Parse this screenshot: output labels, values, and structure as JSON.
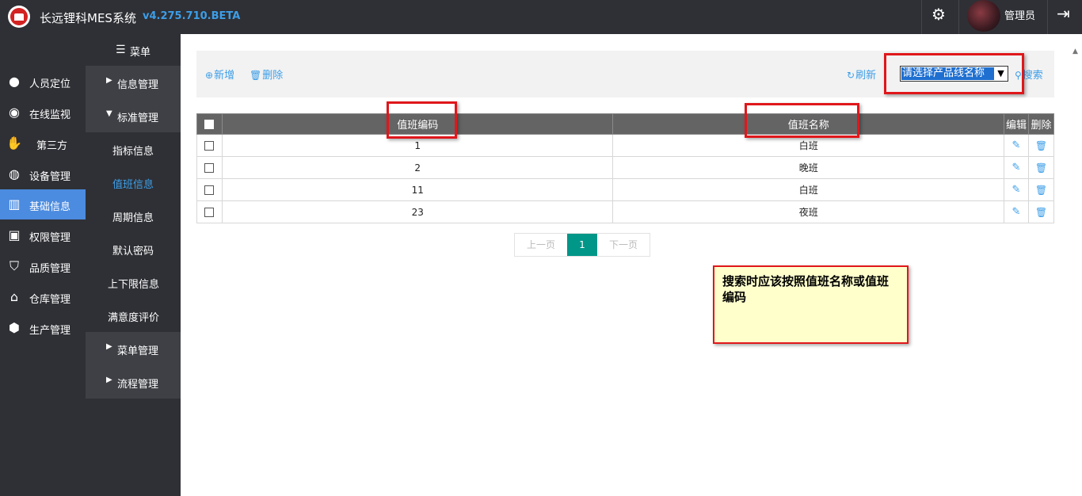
{
  "header": {
    "title": "长远锂科MES系统",
    "version": "v4.275.710.BETA",
    "user": "管理员",
    "icons": [
      "gear-icon",
      "logout-icon",
      "logo-icon"
    ]
  },
  "leftnav": {
    "items": [
      {
        "label": "人员定位",
        "icon": "person-pin-icon"
      },
      {
        "label": "在线监视",
        "icon": "monitor-icon"
      },
      {
        "label": "第三方",
        "icon": "handshake-icon"
      },
      {
        "label": "设备管理",
        "icon": "device-icon"
      },
      {
        "label": "基础信息",
        "icon": "basic-info-icon",
        "active": true
      },
      {
        "label": "权限管理",
        "icon": "lock-icon"
      },
      {
        "label": "品质管理",
        "icon": "shield-icon"
      },
      {
        "label": "仓库管理",
        "icon": "warehouse-icon"
      },
      {
        "label": "生产管理",
        "icon": "production-icon"
      }
    ]
  },
  "subnav": {
    "title": "菜单",
    "groups": [
      {
        "label": "信息管理"
      },
      {
        "label": "标准管理"
      }
    ],
    "leaves": [
      "指标信息",
      "值班信息",
      "周期信息",
      "默认密码",
      "上下限信息",
      "满意度评价"
    ],
    "current_leaf": "值班信息",
    "bottom_groups": [
      "菜单管理",
      "流程管理"
    ]
  },
  "toolbar": {
    "add_label": "新增",
    "delete_label": "删除",
    "refresh_label": "刷新",
    "select_value": "请选择产品线名称",
    "search_label": "搜索"
  },
  "table": {
    "headers": [
      "值班编码",
      "值班名称",
      "编辑",
      "删除"
    ],
    "rows": [
      {
        "code": "1",
        "name": "白班"
      },
      {
        "code": "2",
        "name": "晚班"
      },
      {
        "code": "11",
        "name": "白班"
      },
      {
        "code": "23",
        "name": "夜班"
      }
    ]
  },
  "pager": {
    "prev": "上一页",
    "current": "1",
    "next": "下一页"
  },
  "annotation": {
    "note": "搜索时应该按照值班名称或值班编码"
  },
  "colors": {
    "accent": "#3c9ee8",
    "nav_active": "#4b8be0",
    "pager_current": "#009688",
    "annotation_border": "#e0171b",
    "annotation_fill": "#ffffcc"
  }
}
